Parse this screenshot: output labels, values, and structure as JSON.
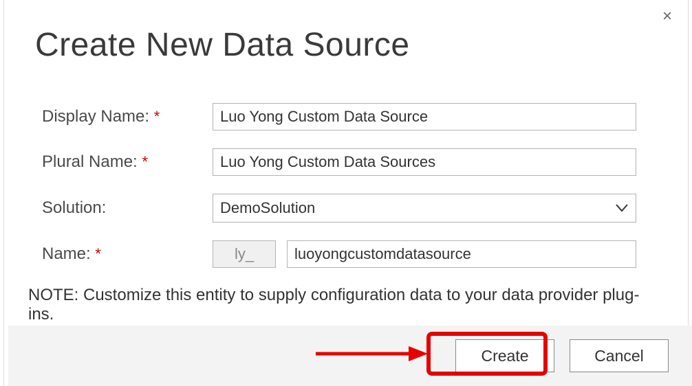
{
  "dialog": {
    "title": "Create New Data Source",
    "close_label": "×"
  },
  "fields": {
    "display_name": {
      "label": "Display Name:",
      "value": "Luo Yong Custom Data Source"
    },
    "plural_name": {
      "label": "Plural Name:",
      "value": "Luo Yong Custom Data Sources"
    },
    "solution": {
      "label": "Solution:",
      "value": "DemoSolution"
    },
    "name": {
      "label": "Name:",
      "prefix": "ly_",
      "value": "luoyongcustomdatasource"
    }
  },
  "note": "NOTE: Customize this entity to supply configuration data to your data provider plug-ins.",
  "buttons": {
    "create": "Create",
    "cancel": "Cancel"
  },
  "required_marker": "*"
}
